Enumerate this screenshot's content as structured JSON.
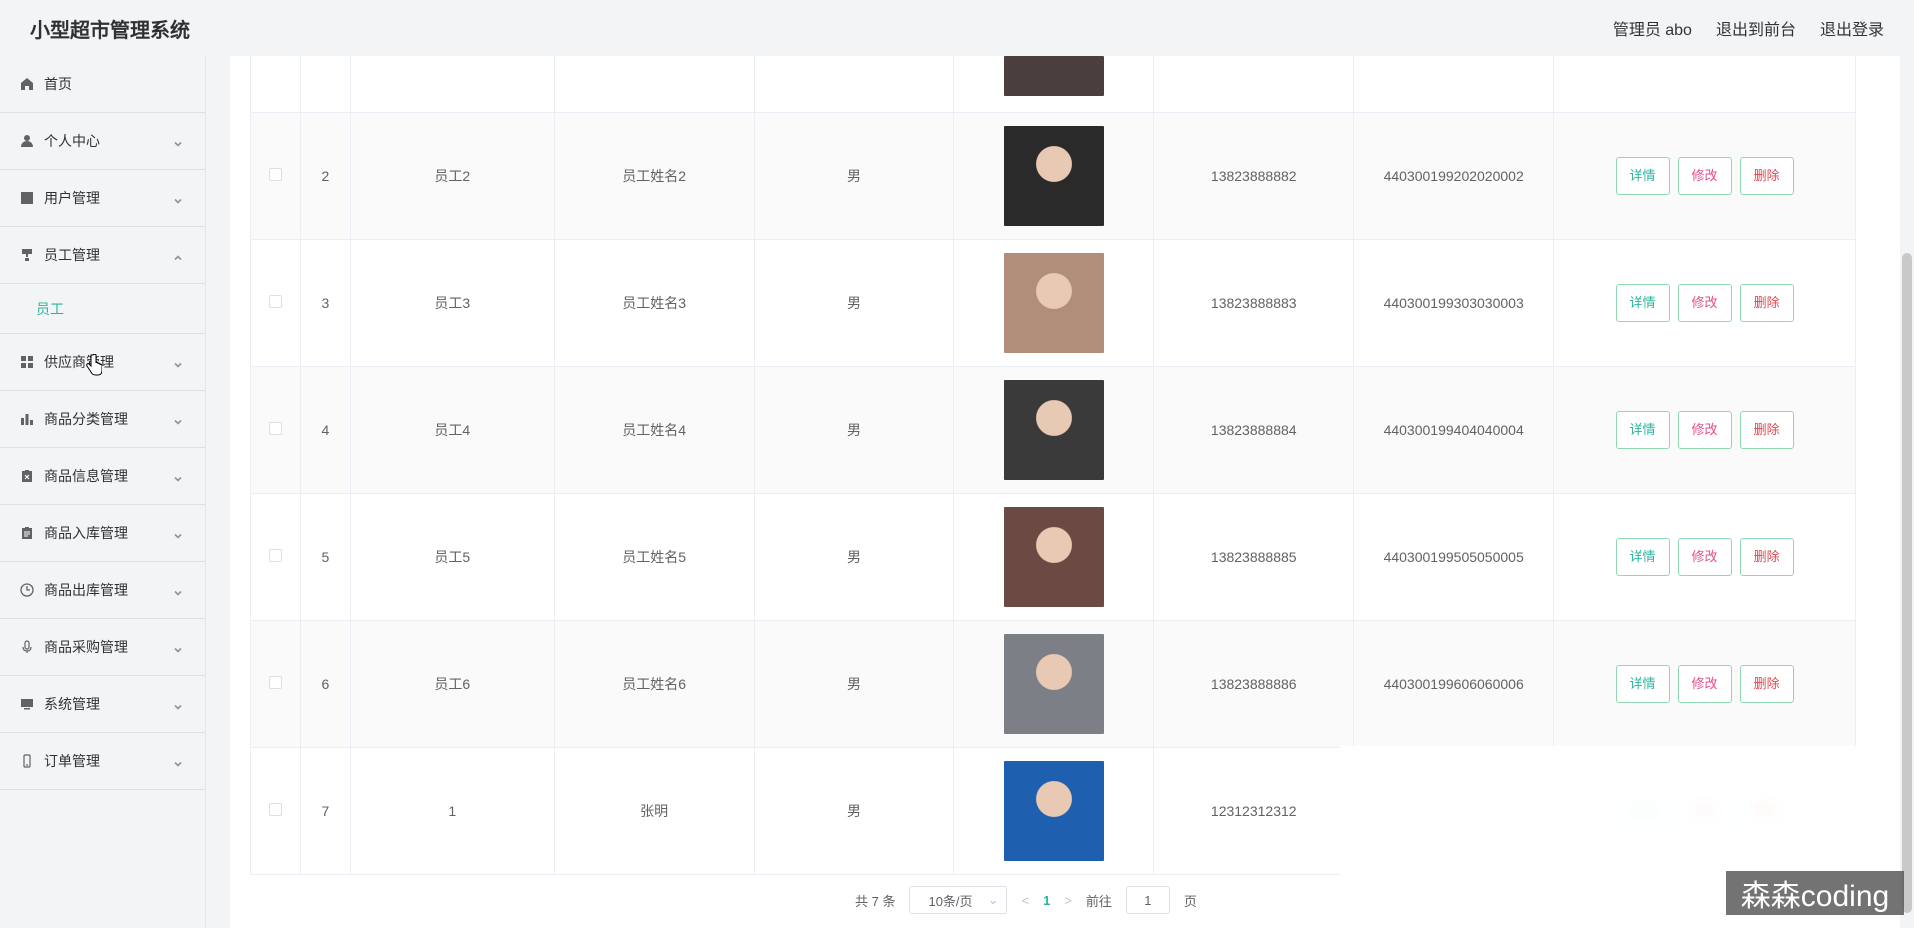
{
  "header": {
    "title": "小型超市管理系统",
    "admin": "管理员 abo",
    "to_front": "退出到前台",
    "logout": "退出登录"
  },
  "sidebar": {
    "items": [
      {
        "label": "首页",
        "icon": "home-icon",
        "expandable": false
      },
      {
        "label": "个人中心",
        "icon": "user-icon",
        "expandable": true
      },
      {
        "label": "用户管理",
        "icon": "chart-line-icon",
        "expandable": true
      },
      {
        "label": "员工管理",
        "icon": "stamp-icon",
        "expandable": true,
        "expanded": true
      },
      {
        "label": "供应商管理",
        "icon": "grid-icon",
        "expandable": true
      },
      {
        "label": "商品分类管理",
        "icon": "bar-chart-icon",
        "expandable": true
      },
      {
        "label": "商品信息管理",
        "icon": "doc-x-icon",
        "expandable": true
      },
      {
        "label": "商品入库管理",
        "icon": "clipboard-icon",
        "expandable": true
      },
      {
        "label": "商品出库管理",
        "icon": "clock-icon",
        "expandable": true
      },
      {
        "label": "商品采购管理",
        "icon": "mic-icon",
        "expandable": true
      },
      {
        "label": "系统管理",
        "icon": "monitor-icon",
        "expandable": true
      },
      {
        "label": "订单管理",
        "icon": "phone-icon",
        "expandable": true
      }
    ],
    "sub_item": "员工"
  },
  "table": {
    "rows": [
      {
        "idx": "2",
        "account": "员工2",
        "name": "员工姓名2",
        "gender": "男",
        "phone": "13823888882",
        "idcard": "440300199202020002",
        "photo_color": "#2a2a2a"
      },
      {
        "idx": "3",
        "account": "员工3",
        "name": "员工姓名3",
        "gender": "男",
        "phone": "13823888883",
        "idcard": "440300199303030003",
        "photo_color": "#b08e7a"
      },
      {
        "idx": "4",
        "account": "员工4",
        "name": "员工姓名4",
        "gender": "男",
        "phone": "13823888884",
        "idcard": "440300199404040004",
        "photo_color": "#3a3a3a"
      },
      {
        "idx": "5",
        "account": "员工5",
        "name": "员工姓名5",
        "gender": "男",
        "phone": "13823888885",
        "idcard": "440300199505050005",
        "photo_color": "#6b4a44"
      },
      {
        "idx": "6",
        "account": "员工6",
        "name": "员工姓名6",
        "gender": "男",
        "phone": "13823888886",
        "idcard": "440300199606060006",
        "photo_color": "#7d7f86"
      },
      {
        "idx": "7",
        "account": "1",
        "name": "张明",
        "gender": "男",
        "phone": "12312312312",
        "idcard": "",
        "photo_color": "#1e5fb0"
      }
    ],
    "buttons": {
      "detail": "详情",
      "edit": "修改",
      "delete": "删除"
    }
  },
  "pagination": {
    "total": "共 7 条",
    "page_size": "10条/页",
    "current_page": "1",
    "goto_label": "前往",
    "goto_value": "1",
    "page_suffix": "页"
  },
  "watermark": "森森coding",
  "colors": {
    "accent": "#2bb5a0",
    "edit": "#e54d8a",
    "delete": "#e0474f",
    "btn_border": "#8ed8b4"
  }
}
